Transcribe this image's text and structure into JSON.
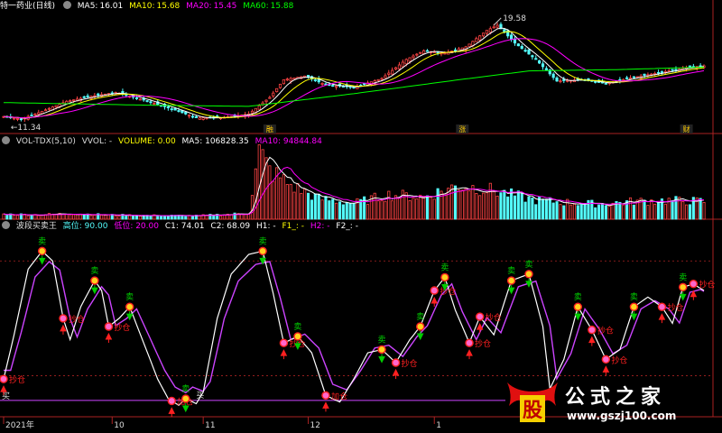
{
  "colors": {
    "bg": "#000000",
    "up": "#ff4444",
    "down": "#54fcfc",
    "ma5": "#ffffff",
    "ma10": "#ffff00",
    "ma20": "#ff00ff",
    "ma60": "#00ff00",
    "sell": "#00cc00",
    "buy": "#ff2020",
    "osc_main": "#ffffff",
    "osc_sig": "#cc44ff",
    "grid": "#aa2222"
  },
  "header_main": {
    "title": "特一药业(日线)",
    "ma5_label": "MA5:",
    "ma5_value": "16.01",
    "ma10_label": "MA10:",
    "ma10_value": "15.68",
    "ma20_label": "MA20:",
    "ma20_value": "15.45",
    "ma60_label": "MA60:",
    "ma60_value": "15.88"
  },
  "header_vol": {
    "name": "VOL-TDX(5,10)",
    "vvol": "VVOL: -",
    "volume": "VOLUME: 0.00",
    "ma5": "MA5: 106828.35",
    "ma10": "MA10: 94844.84"
  },
  "header_osc": {
    "name": "波段买卖王",
    "high": "高位: 90.00",
    "low": "低位: 20.00",
    "c1": "C1: 74.01",
    "c2": "C2: 68.09",
    "h1": "H1: -",
    "f1": "F1_: -",
    "h2": "H2: -",
    "f2": "F2_: -"
  },
  "watermark": {
    "badge": "股",
    "text": "公式之家",
    "url": "www.gszj100.com"
  },
  "chart_data": [
    {
      "type": "candlestick",
      "panel": "price",
      "ylim": [
        10.8,
        20.2
      ],
      "annotations": [
        {
          "text": "19.58",
          "kind": "high",
          "x_index": 140
        },
        {
          "text": "11.34",
          "kind": "low",
          "x_index": 1
        }
      ],
      "event_labels": [
        {
          "text": "融",
          "x_index": 76
        },
        {
          "text": "涨",
          "x_index": 131
        },
        {
          "text": "财",
          "x_index": 195
        }
      ],
      "series_close_keypoints": [
        [
          0,
          12.0
        ],
        [
          5,
          11.8
        ],
        [
          10,
          12.3
        ],
        [
          18,
          13.2
        ],
        [
          25,
          13.6
        ],
        [
          32,
          13.9
        ],
        [
          40,
          13.3
        ],
        [
          48,
          12.6
        ],
        [
          55,
          11.9
        ],
        [
          62,
          11.9
        ],
        [
          70,
          12.2
        ],
        [
          76,
          13.5
        ],
        [
          80,
          14.9
        ],
        [
          86,
          15.2
        ],
        [
          92,
          14.5
        ],
        [
          100,
          14.3
        ],
        [
          108,
          15.0
        ],
        [
          115,
          16.5
        ],
        [
          120,
          17.2
        ],
        [
          126,
          17.0
        ],
        [
          132,
          17.5
        ],
        [
          138,
          18.8
        ],
        [
          141,
          19.2
        ],
        [
          146,
          17.8
        ],
        [
          152,
          16.5
        ],
        [
          158,
          14.8
        ],
        [
          165,
          14.9
        ],
        [
          172,
          14.6
        ],
        [
          180,
          15.1
        ],
        [
          188,
          15.5
        ],
        [
          196,
          15.9
        ],
        [
          200,
          16.0
        ]
      ],
      "ma_keypoints": {
        "MA60": [
          [
            0,
            13.1
          ],
          [
            40,
            12.9
          ],
          [
            70,
            12.8
          ],
          [
            100,
            13.8
          ],
          [
            130,
            14.9
          ],
          [
            150,
            15.6
          ],
          [
            175,
            15.7
          ],
          [
            200,
            15.9
          ]
        ]
      }
    },
    {
      "type": "bar",
      "panel": "volume",
      "ylim": [
        0,
        380000
      ],
      "volume_keypoints": [
        [
          0,
          26000
        ],
        [
          10,
          24000
        ],
        [
          20,
          30000
        ],
        [
          30,
          22000
        ],
        [
          40,
          20000
        ],
        [
          55,
          18000
        ],
        [
          62,
          24000
        ],
        [
          70,
          32000
        ],
        [
          73,
          360000
        ],
        [
          76,
          260000
        ],
        [
          82,
          180000
        ],
        [
          90,
          110000
        ],
        [
          100,
          85000
        ],
        [
          110,
          130000
        ],
        [
          120,
          120000
        ],
        [
          130,
          180000
        ],
        [
          138,
          160000
        ],
        [
          145,
          130000
        ],
        [
          152,
          100000
        ],
        [
          160,
          90000
        ],
        [
          170,
          80000
        ],
        [
          180,
          95000
        ],
        [
          190,
          100000
        ],
        [
          200,
          95000
        ]
      ]
    },
    {
      "type": "line",
      "panel": "oscillator",
      "ylim": [
        -5,
        105
      ],
      "levels": {
        "high": 90,
        "low": 20,
        "buy_line": 5
      },
      "main_keypoints": [
        [
          0,
          18
        ],
        [
          3,
          45
        ],
        [
          7,
          85
        ],
        [
          11,
          96
        ],
        [
          14,
          90
        ],
        [
          17,
          55
        ],
        [
          19,
          42
        ],
        [
          22,
          62
        ],
        [
          26,
          78
        ],
        [
          28,
          72
        ],
        [
          30,
          50
        ],
        [
          33,
          55
        ],
        [
          36,
          62
        ],
        [
          40,
          40
        ],
        [
          44,
          18
        ],
        [
          47,
          6
        ],
        [
          50,
          2
        ],
        [
          52,
          6
        ],
        [
          55,
          3
        ],
        [
          57,
          10
        ],
        [
          61,
          55
        ],
        [
          65,
          82
        ],
        [
          70,
          94
        ],
        [
          74,
          96
        ],
        [
          77,
          70
        ],
        [
          80,
          40
        ],
        [
          84,
          44
        ],
        [
          88,
          34
        ],
        [
          92,
          8
        ],
        [
          96,
          4
        ],
        [
          100,
          18
        ],
        [
          104,
          34
        ],
        [
          108,
          36
        ],
        [
          112,
          28
        ],
        [
          116,
          42
        ],
        [
          119,
          50
        ],
        [
          123,
          72
        ],
        [
          126,
          80
        ],
        [
          129,
          60
        ],
        [
          133,
          40
        ],
        [
          136,
          56
        ],
        [
          140,
          45
        ],
        [
          145,
          78
        ],
        [
          150,
          82
        ],
        [
          154,
          50
        ],
        [
          156,
          12
        ],
        [
          160,
          30
        ],
        [
          164,
          62
        ],
        [
          168,
          48
        ],
        [
          172,
          30
        ],
        [
          176,
          36
        ],
        [
          180,
          62
        ],
        [
          184,
          68
        ],
        [
          188,
          62
        ],
        [
          191,
          52
        ],
        [
          194,
          74
        ],
        [
          197,
          76
        ],
        [
          200,
          72
        ]
      ],
      "signals": [
        {
          "x_index": 0,
          "kind": "buy_arrow",
          "label": "抄仓"
        },
        {
          "x_index": 11,
          "kind": "sell_arrow",
          "label": "卖"
        },
        {
          "x_index": 17,
          "kind": "buy_arrow",
          "label": "抄仓"
        },
        {
          "x_index": 26,
          "kind": "sell_arrow",
          "label": "卖"
        },
        {
          "x_index": 30,
          "kind": "buy_arrow",
          "label": "抄仓"
        },
        {
          "x_index": 36,
          "kind": "sell_arrow",
          "label": "卖"
        },
        {
          "x_index": 48,
          "kind": "buy_arrow",
          "label": "加仓"
        },
        {
          "x_index": 52,
          "kind": "sell_arrow",
          "label": "卖"
        },
        {
          "x_index": 55,
          "kind": "buy_line",
          "label": "买"
        },
        {
          "x_index": 74,
          "kind": "sell_arrow",
          "label": "卖"
        },
        {
          "x_index": 80,
          "kind": "buy_arrow",
          "label": "抄仓"
        },
        {
          "x_index": 84,
          "kind": "sell_arrow",
          "label": "卖"
        },
        {
          "x_index": 92,
          "kind": "buy_arrow",
          "label": "加仓"
        },
        {
          "x_index": 108,
          "kind": "sell_arrow",
          "label": "卖"
        },
        {
          "x_index": 112,
          "kind": "buy_arrow",
          "label": "抄仓"
        },
        {
          "x_index": 119,
          "kind": "sell_arrow",
          "label": "卖"
        },
        {
          "x_index": 123,
          "kind": "buy_arrow",
          "label": "抄仓"
        },
        {
          "x_index": 126,
          "kind": "sell_arrow",
          "label": "卖"
        },
        {
          "x_index": 133,
          "kind": "buy_arrow",
          "label": "抄仓"
        },
        {
          "x_index": 136,
          "kind": "buy_arrow",
          "label": "抄仓"
        },
        {
          "x_index": 145,
          "kind": "sell_arrow",
          "label": "卖"
        },
        {
          "x_index": 150,
          "kind": "sell_arrow",
          "label": "卖"
        },
        {
          "x_index": 164,
          "kind": "sell_arrow",
          "label": "卖"
        },
        {
          "x_index": 168,
          "kind": "buy_arrow",
          "label": "抄仓"
        },
        {
          "x_index": 172,
          "kind": "buy_arrow",
          "label": "抄仓"
        },
        {
          "x_index": 180,
          "kind": "sell_arrow",
          "label": "卖"
        },
        {
          "x_index": 188,
          "kind": "buy_arrow",
          "label": "抄仓"
        },
        {
          "x_index": 194,
          "kind": "sell_arrow",
          "label": "卖"
        },
        {
          "x_index": 197,
          "kind": "buy_arrow",
          "label": "抄仓"
        }
      ],
      "buy_label": "买"
    }
  ],
  "x_axis": {
    "count": 201,
    "ticks": [
      {
        "label": "2021年",
        "x_index": 0
      },
      {
        "label": "10",
        "x_index": 31
      },
      {
        "label": "11",
        "x_index": 57
      },
      {
        "label": "12",
        "x_index": 87
      },
      {
        "label": "1",
        "x_index": 123
      }
    ]
  }
}
